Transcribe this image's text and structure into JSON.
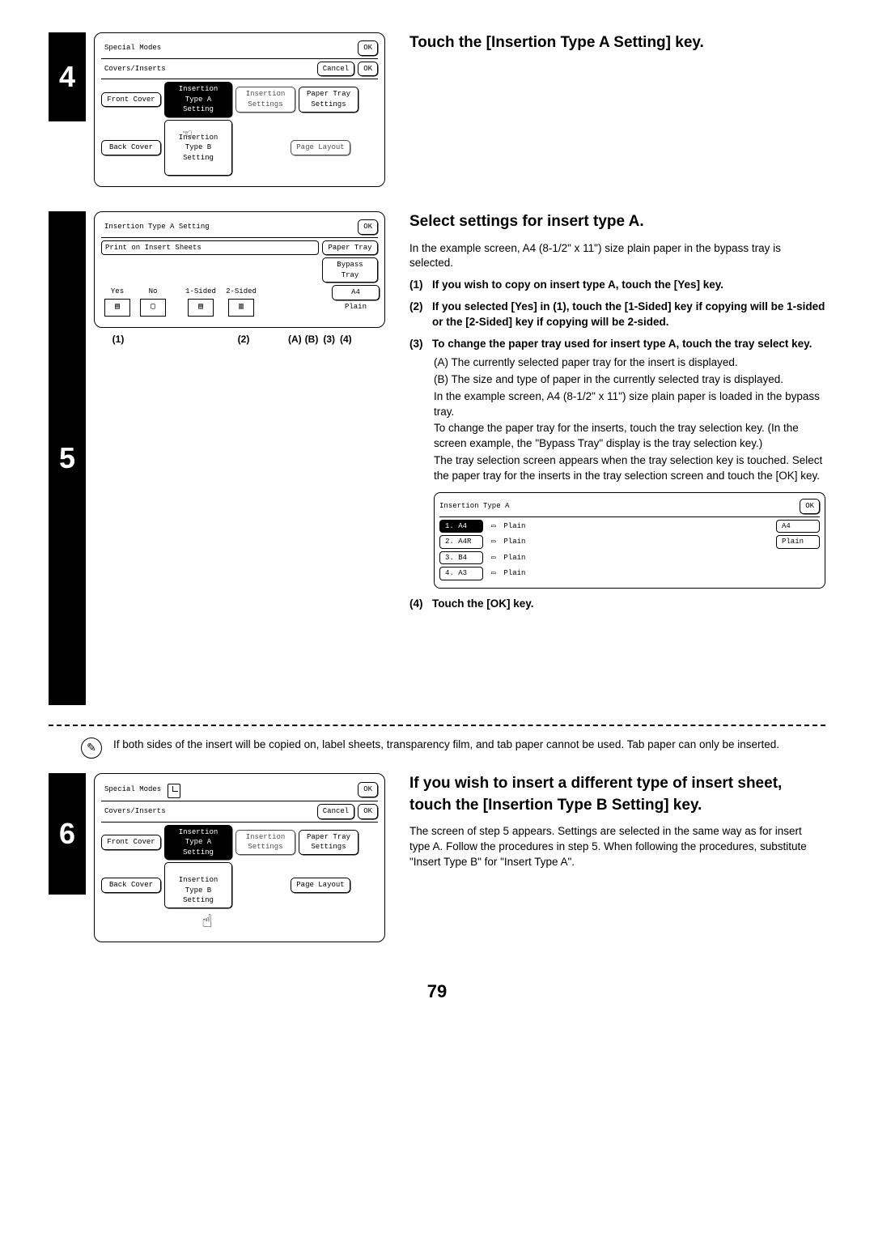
{
  "step4": {
    "num": "4",
    "heading": "Touch the [Insertion Type A Setting] key.",
    "lcd": {
      "title": "Special Modes",
      "ok": "OK",
      "sub_title": "Covers/Inserts",
      "cancel": "Cancel",
      "ok2": "OK",
      "btn_front": "Front Cover",
      "btn_typeA": "Insertion\nType A Setting",
      "btn_ins_set": "Insertion\nSettings",
      "btn_ptray": "Paper Tray\nSettings",
      "btn_back": "Back Cover",
      "btn_typeB_partial": "Insertion\nType B Setting",
      "btn_layout": "Page Layout"
    }
  },
  "step5": {
    "num": "5",
    "heading": "Select settings for insert type A.",
    "intro": "In the example screen, A4 (8-1/2\" x 11\") size plain paper in the bypass tray is selected.",
    "item1_num": "(1)",
    "item1": "If you wish to copy on insert type A, touch the [Yes] key.",
    "item2_num": "(2)",
    "item2": "If you selected [Yes] in (1), touch the [1-Sided] key if copying will be 1-sided or the [2-Sided] key if copying will be 2-sided.",
    "item3_num": "(3)",
    "item3": "To change the paper tray used for insert type A, touch the tray select key.",
    "subA": "(A) The currently selected paper tray for the insert is displayed.",
    "subB": "(B) The size and type of paper in the currently selected tray is displayed.",
    "sub_example": "In the example screen, A4 (8-1/2\" x 11\") size plain paper is loaded in the bypass tray.",
    "sub_change": "To change the paper tray for the inserts, touch the tray selection key. (In the screen example, the \"Bypass Tray\" display is the tray selection key.)",
    "sub_appear": "The tray selection screen appears when the tray selection key is touched. Select the paper tray for the inserts in the tray selection screen and touch the [OK] key.",
    "item4_num": "(4)",
    "item4": "Touch the [OK] key.",
    "lcd": {
      "title": "Insertion Type A Setting",
      "ok": "OK",
      "sub": "Print on Insert Sheets",
      "ptray_lbl": "Paper Tray",
      "bypass": "Bypass\nTray",
      "yes": "Yes",
      "no": "No",
      "one": "1-Sided",
      "two": "2-Sided",
      "a4": "A4",
      "plain": "Plain"
    },
    "callouts": {
      "c1": "(1)",
      "c2": "(2)",
      "cA": "(A)",
      "cB": "(B)",
      "c3": "(3)",
      "c4": "(4)"
    },
    "tray_panel": {
      "title": "Insertion Type A",
      "ok": "OK",
      "r1_size": "1. A4",
      "r1_type": "Plain",
      "r1_right": "A4",
      "r2_size": "2. A4R",
      "r2_type": "Plain",
      "r2_right": "Plain",
      "r3_size": "3. B4",
      "r3_type": "Plain",
      "r4_size": "4. A3",
      "r4_type": "Plain"
    }
  },
  "note": "If both sides of the insert will be copied on, label sheets, transparency film, and tab paper cannot be used. Tab paper can only be inserted.",
  "step6": {
    "num": "6",
    "heading": "If you wish to insert a different type of insert sheet, touch the [Insertion Type B Setting] key.",
    "body": "The screen of step 5 appears. Settings are selected in the same way as for insert type A. Follow the procedures in step 5. When following the procedures, substitute \"Insert Type B\" for \"Insert Type A\".",
    "lcd": {
      "title": "Special Modes",
      "ok": "OK",
      "sub_title": "Covers/Inserts",
      "cancel": "Cancel",
      "ok2": "OK",
      "btn_front": "Front Cover",
      "btn_typeA": "Insertion\nType A Setting",
      "btn_ins_set": "Insertion\nSettings",
      "btn_ptray": "Paper Tray\nSettings",
      "btn_back": "Back Cover",
      "btn_typeB": "Insertion\nType B Setting",
      "btn_layout": "Page Layout"
    }
  },
  "page_number": "79"
}
